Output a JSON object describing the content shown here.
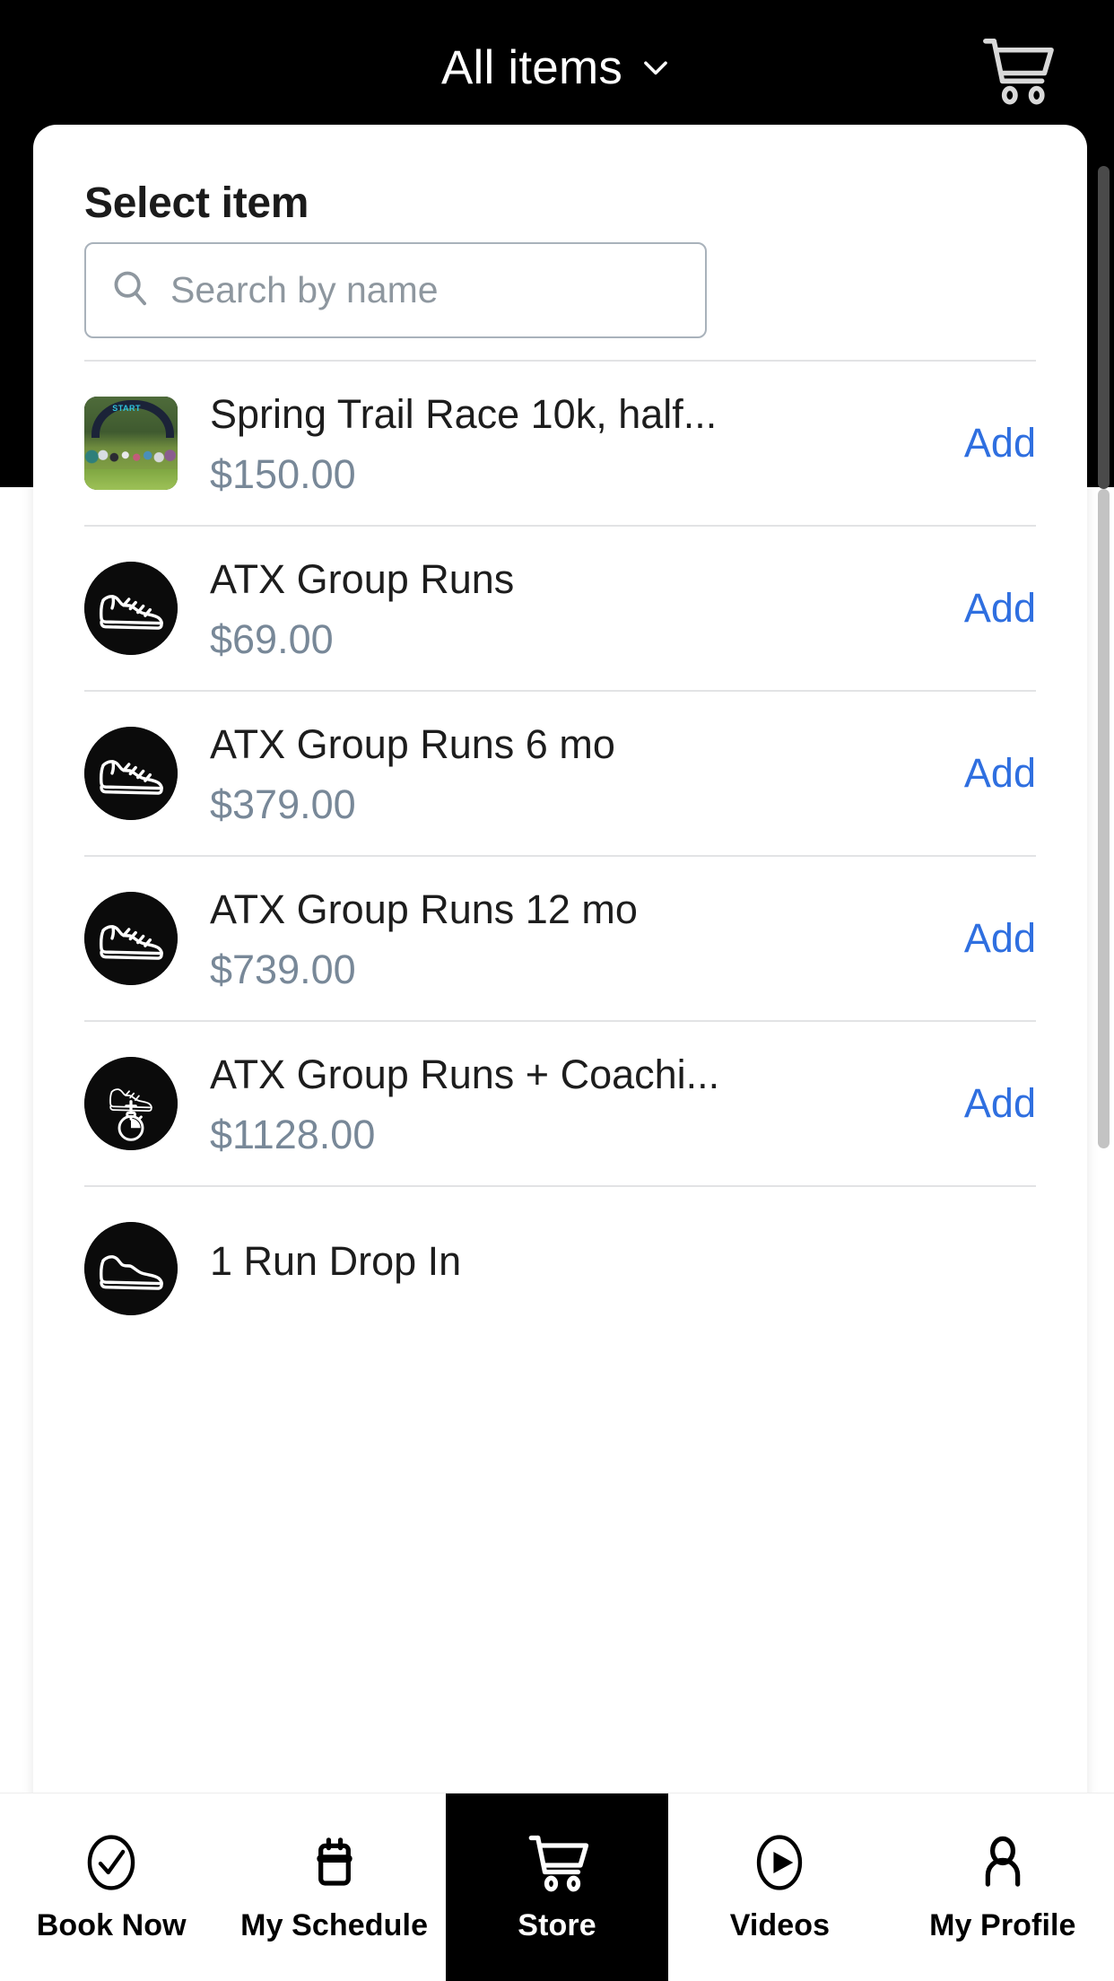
{
  "appbar": {
    "title": "All items",
    "chevron_icon": "chevron-down-icon",
    "cart_icon": "shopping-cart-icon"
  },
  "sheet": {
    "title": "Select item"
  },
  "search": {
    "icon": "search-icon",
    "placeholder": "Search by name",
    "value": ""
  },
  "items": [
    {
      "name": "Spring Trail Race 10k, half...",
      "price": "$150.00",
      "add_label": "Add",
      "thumb_type": "photo",
      "thumb_icon": "race-start-arch-photo"
    },
    {
      "name": "ATX Group Runs",
      "price": "$69.00",
      "add_label": "Add",
      "thumb_type": "icon",
      "thumb_icon": "running-shoe-icon"
    },
    {
      "name": "ATX Group Runs 6 mo",
      "price": "$379.00",
      "add_label": "Add",
      "thumb_type": "icon",
      "thumb_icon": "running-shoe-icon"
    },
    {
      "name": "ATX Group Runs 12 mo",
      "price": "$739.00",
      "add_label": "Add",
      "thumb_type": "icon",
      "thumb_icon": "running-shoe-icon"
    },
    {
      "name": "ATX Group Runs + Coachi...",
      "price": "$1128.00",
      "add_label": "Add",
      "thumb_type": "icon",
      "thumb_icon": "shoe-plus-stopwatch-icon"
    },
    {
      "name": "1 Run Drop In",
      "price": "",
      "add_label": "",
      "thumb_type": "icon",
      "thumb_icon": "running-shoe-icon"
    }
  ],
  "bottom_nav": [
    {
      "label": "Book Now",
      "icon": "check-circle-icon",
      "active": false
    },
    {
      "label": "My Schedule",
      "icon": "calendar-icon",
      "active": false
    },
    {
      "label": "Store",
      "icon": "shopping-cart-icon",
      "active": true
    },
    {
      "label": "Videos",
      "icon": "play-circle-icon",
      "active": false
    },
    {
      "label": "My Profile",
      "icon": "person-icon",
      "active": false
    }
  ],
  "colors": {
    "accent_link": "#2f6fe0",
    "price_text": "#788898",
    "appbar_bg": "#000000",
    "sheet_bg": "#ffffff",
    "divider": "#e2e3e5",
    "search_border": "#a9b2bb"
  }
}
